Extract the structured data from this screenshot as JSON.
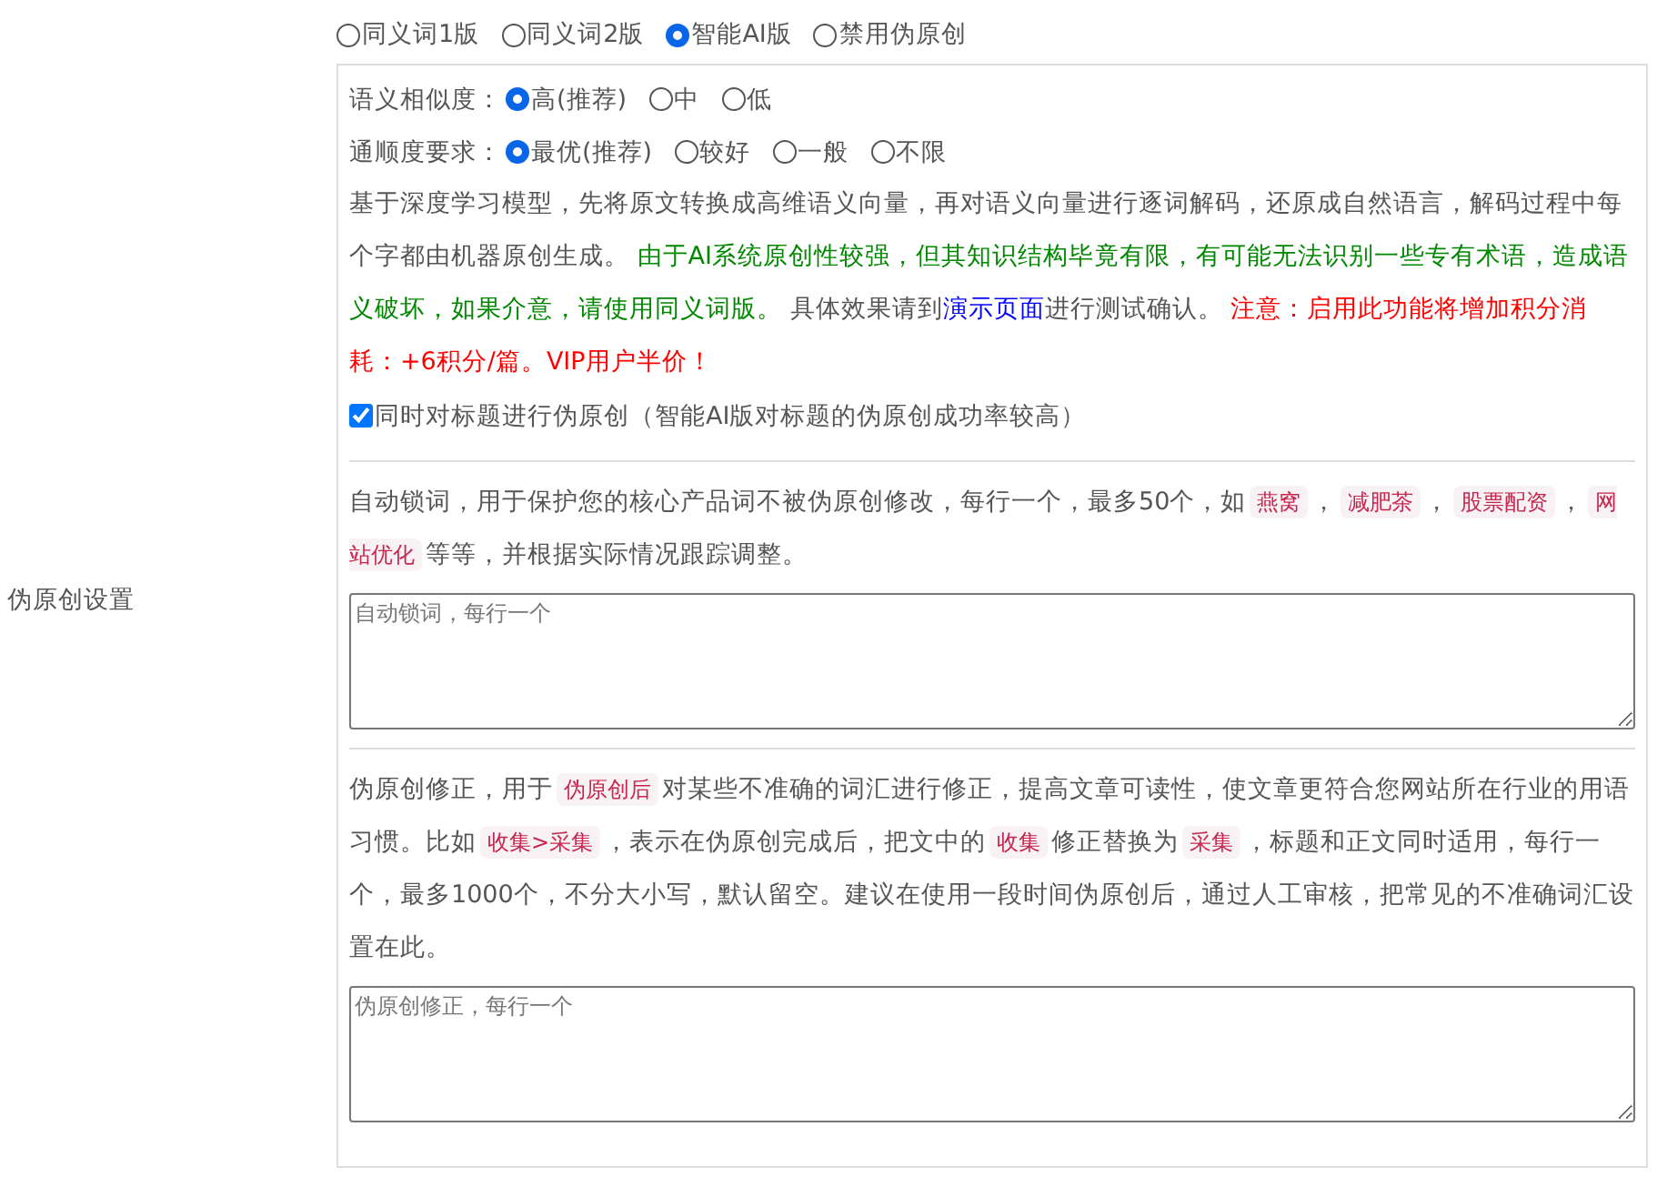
{
  "section_label": "伪原创设置",
  "version_options": [
    {
      "label": "同义词1版",
      "selected": false
    },
    {
      "label": "同义词2版",
      "selected": false
    },
    {
      "label": "智能AI版",
      "selected": true
    },
    {
      "label": "禁用伪原创",
      "selected": false
    }
  ],
  "similarity": {
    "label": "语义相似度：",
    "options": [
      {
        "label": "高(推荐)",
        "selected": true
      },
      {
        "label": "中",
        "selected": false
      },
      {
        "label": "低",
        "selected": false
      }
    ]
  },
  "fluency": {
    "label": "通顺度要求：",
    "options": [
      {
        "label": "最优(推荐)",
        "selected": true
      },
      {
        "label": "较好",
        "selected": false
      },
      {
        "label": "一般",
        "selected": false
      },
      {
        "label": "不限",
        "selected": false
      }
    ]
  },
  "ai_description": [
    {
      "kind": "plain",
      "text": "基于深度学习模型，先将原文转换成高维语义向量，再对语义向量进行逐词解码，还原成自然语言，解码过程中每个字都由机器原创生成。 "
    },
    {
      "kind": "green",
      "text": "由于AI系统原创性较强，但其知识结构毕竟有限，有可能无法识别一些专有术语，造成语义破坏，如果介意，请使用同义词版。"
    },
    {
      "kind": "plain",
      "text": " 具体效果请到"
    },
    {
      "kind": "link",
      "text": "演示页面"
    },
    {
      "kind": "plain",
      "text": "进行测试确认。 "
    },
    {
      "kind": "red",
      "text": "注意：启用此功能将增加积分消耗：+6积分/篇。VIP用户半价！"
    }
  ],
  "title_option": {
    "label": "同时对标题进行伪原创（智能AI版对标题的伪原创成功率较高）",
    "checked": true
  },
  "lock_words": {
    "description": [
      {
        "kind": "plain",
        "text": "自动锁词，用于保护您的核心产品词不被伪原创修改，每行一个，最多50个，如"
      },
      {
        "kind": "code",
        "text": "燕窝"
      },
      {
        "kind": "plain",
        "text": "，"
      },
      {
        "kind": "code",
        "text": "减肥茶"
      },
      {
        "kind": "plain",
        "text": "，"
      },
      {
        "kind": "code",
        "text": "股票配资"
      },
      {
        "kind": "plain",
        "text": "，"
      },
      {
        "kind": "code",
        "text": "网站优化"
      },
      {
        "kind": "plain",
        "text": "等等，并根据实际情况跟踪调整。"
      }
    ],
    "placeholder": "自动锁词，每行一个"
  },
  "correction": {
    "description": [
      {
        "kind": "plain",
        "text": "伪原创修正，用于"
      },
      {
        "kind": "code",
        "text": "伪原创后"
      },
      {
        "kind": "plain",
        "text": "对某些不准确的词汇进行修正，提高文章可读性，使文章更符合您网站所在行业的用语习惯。比如"
      },
      {
        "kind": "code",
        "text": "收集>采集"
      },
      {
        "kind": "plain",
        "text": "，表示在伪原创完成后，把文中的"
      },
      {
        "kind": "code",
        "text": "收集"
      },
      {
        "kind": "plain",
        "text": "修正替换为"
      },
      {
        "kind": "code",
        "text": "采集"
      },
      {
        "kind": "plain",
        "text": "，标题和正文同时适用，每行一个，最多1000个，不分大小写，默认留空。建议在使用一段时间伪原创后，通过人工审核，把常见的不准确词汇设置在此。"
      }
    ],
    "placeholder": "伪原创修正，每行一个"
  }
}
